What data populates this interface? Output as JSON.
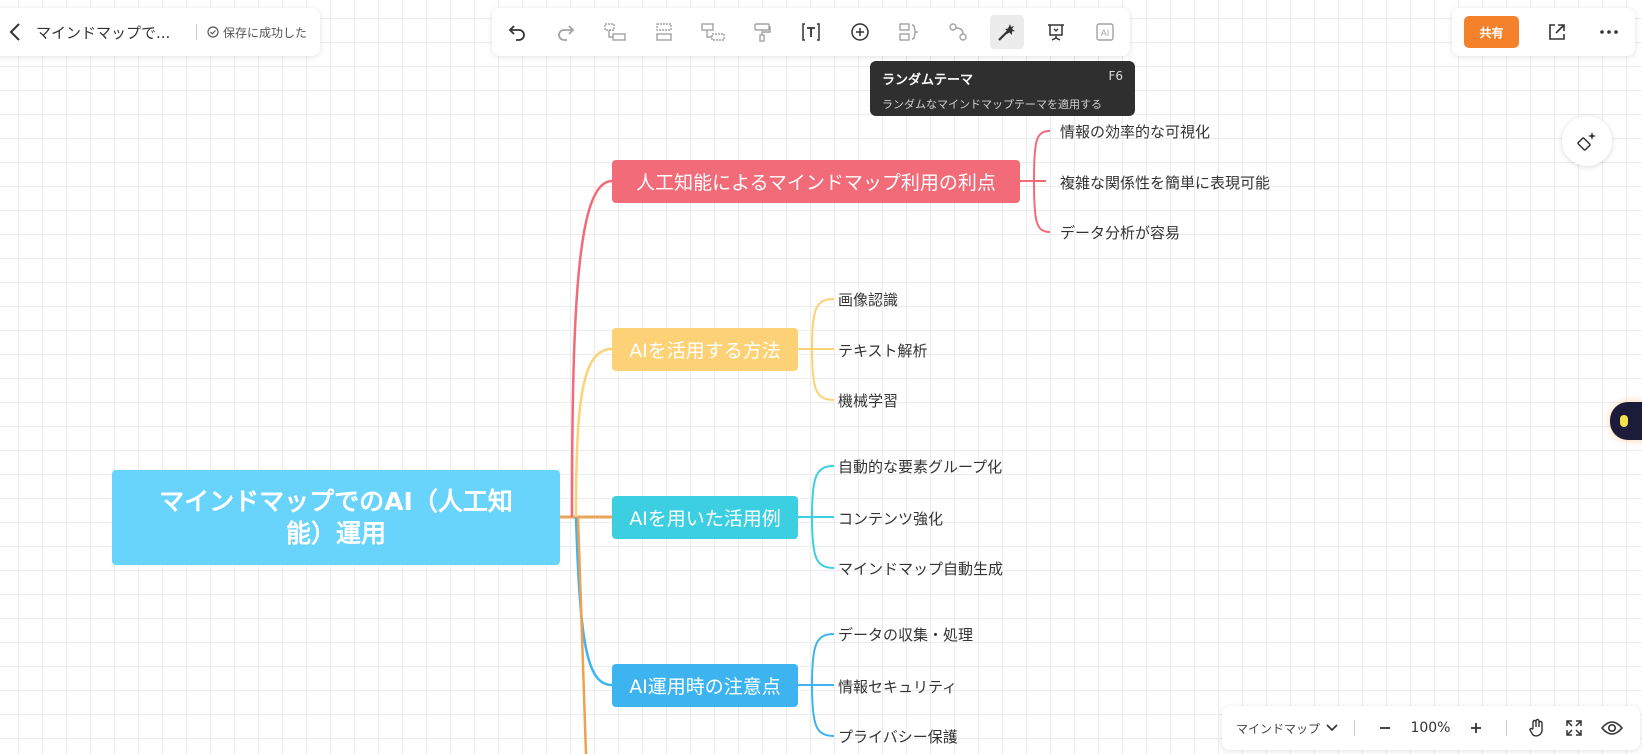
{
  "header": {
    "doc_title": "マインドマップで...",
    "save_status": "保存に成功した"
  },
  "toolbar": {
    "tools": [
      {
        "name": "undo-icon",
        "enabled": true
      },
      {
        "name": "redo-icon",
        "enabled": false
      },
      {
        "name": "add-child-icon",
        "enabled": false
      },
      {
        "name": "add-sibling-icon",
        "enabled": false
      },
      {
        "name": "add-parent-icon",
        "enabled": false
      },
      {
        "name": "format-painter-icon",
        "enabled": false
      },
      {
        "name": "text-icon",
        "enabled": true
      },
      {
        "name": "insert-icon",
        "enabled": true
      },
      {
        "name": "summary-icon",
        "enabled": false
      },
      {
        "name": "relation-line-icon",
        "enabled": false
      },
      {
        "name": "random-theme-icon",
        "enabled": true,
        "active": true
      },
      {
        "name": "presentation-icon",
        "enabled": true
      },
      {
        "name": "ai-icon",
        "enabled": false
      }
    ]
  },
  "tooltip": {
    "title": "ランダムテーマ",
    "shortcut": "F6",
    "description": "ランダムなマインドマップテーマを適用する"
  },
  "actions": {
    "share_label": "共有"
  },
  "footer": {
    "view_mode": "マインドマップ",
    "zoom": "100%"
  },
  "mindmap": {
    "root": "マインドマップでのAI（人工知能）運用",
    "branches": [
      {
        "label": "人工知能によるマインドマップ利用の利点",
        "color": "#f16b79",
        "children": [
          "情報の効率的な可視化",
          "複雑な関係性を簡単に表現可能",
          "データ分析が容易"
        ]
      },
      {
        "label": "AIを活用する方法",
        "color": "#fdd176",
        "children": [
          "画像認識",
          "テキスト解析",
          "機械学習"
        ]
      },
      {
        "label": "AIを用いた活用例",
        "color": "#3ccfe2",
        "children": [
          "自動的な要素グループ化",
          "コンテンツ強化",
          "マインドマップ自動生成"
        ]
      },
      {
        "label": "AI運用時の注意点",
        "color": "#3db4ef",
        "children": [
          "データの収集・処理",
          "情報セキュリティ",
          "プライバシー保護"
        ]
      }
    ]
  }
}
